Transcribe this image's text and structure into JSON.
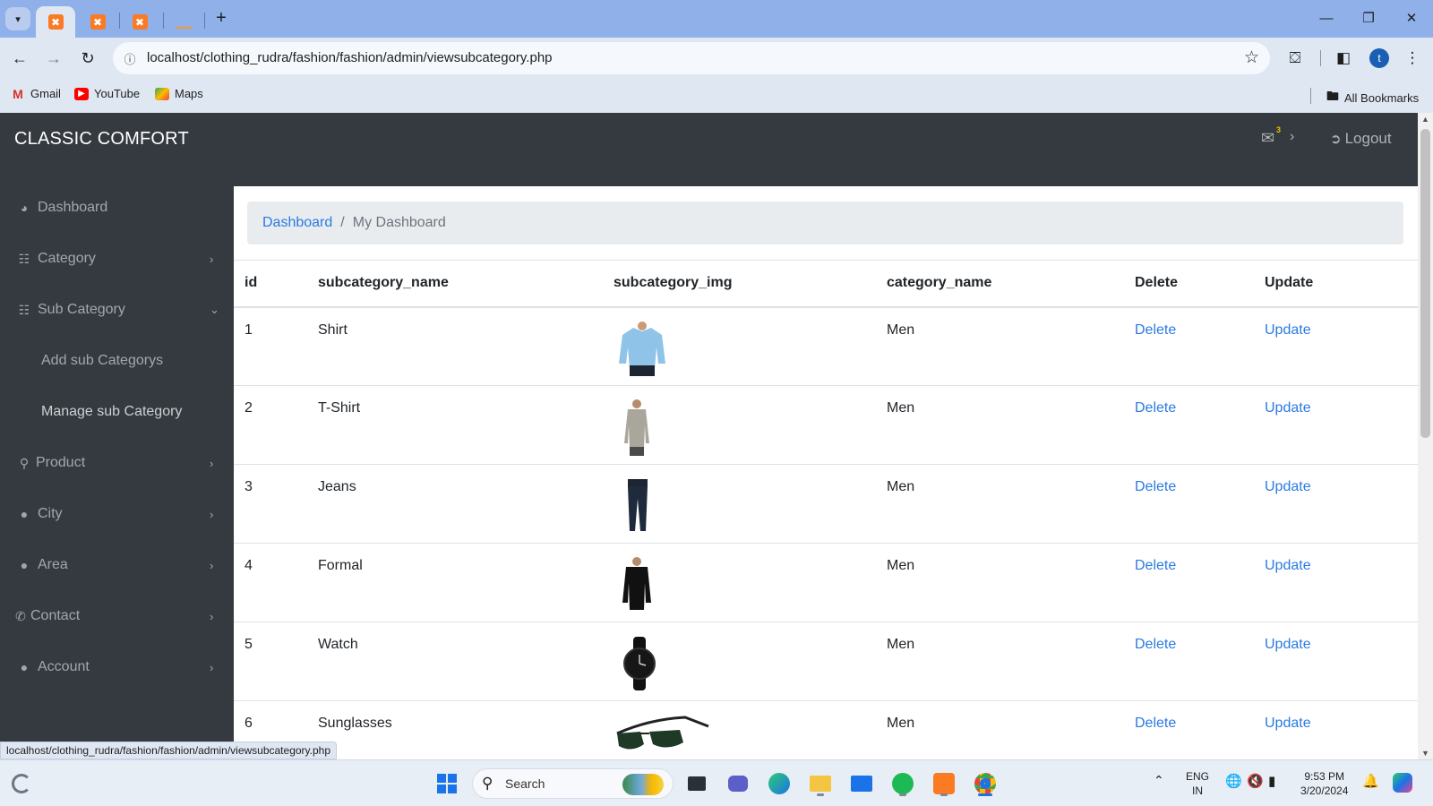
{
  "browser": {
    "tabs": [
      {
        "icon": "xampp-icon",
        "active": true
      },
      {
        "icon": "xampp-icon",
        "active": false
      },
      {
        "icon": "xampp-icon",
        "active": false
      },
      {
        "icon": "phpmyadmin-icon",
        "active": false
      }
    ],
    "url": "localhost/clothing_rudra/fashion/fashion/admin/viewsubcategory.php",
    "profile_initial": "t",
    "bookmarks": [
      {
        "label": "Gmail",
        "icon": "gmail-icon"
      },
      {
        "label": "YouTube",
        "icon": "youtube-icon"
      },
      {
        "label": "Maps",
        "icon": "maps-icon"
      }
    ],
    "all_bookmarks": "All Bookmarks",
    "status_url": "localhost/clothing_rudra/fashion/fashion/admin/viewsubcategory.php"
  },
  "app": {
    "brand": "CLASSIC COMFORT",
    "mail_badge": "3",
    "logout": "Logout"
  },
  "sidebar": {
    "items": [
      {
        "label": "Dashboard",
        "icon": "dashboard-icon",
        "chevron": ""
      },
      {
        "label": "Category",
        "icon": "sitemap-icon",
        "chevron": "›"
      },
      {
        "label": "Sub Category",
        "icon": "sitemap-icon",
        "chevron": "⌄"
      },
      {
        "label": "Add sub Categorys",
        "sub": true
      },
      {
        "label": "Manage sub Category",
        "sub": true
      },
      {
        "label": "Product",
        "icon": "basket-icon",
        "chevron": "›"
      },
      {
        "label": "City",
        "icon": "user-icon",
        "chevron": "›"
      },
      {
        "label": "Area",
        "icon": "user-icon",
        "chevron": "›"
      },
      {
        "label": "Contact",
        "icon": "phone-icon",
        "chevron": "›"
      },
      {
        "label": "Account",
        "icon": "user-icon",
        "chevron": "›"
      }
    ]
  },
  "breadcrumb": {
    "link": "Dashboard",
    "separator": "/",
    "current": "My Dashboard"
  },
  "table": {
    "headers": [
      "id",
      "subcategory_name",
      "subcategory_img",
      "category_name",
      "Delete",
      "Update"
    ],
    "rows": [
      {
        "id": "1",
        "name": "Shirt",
        "img": "shirt-image",
        "category": "Men",
        "delete": "Delete",
        "update": "Update"
      },
      {
        "id": "2",
        "name": "T-Shirt",
        "img": "tshirt-image",
        "category": "Men",
        "delete": "Delete",
        "update": "Update"
      },
      {
        "id": "3",
        "name": "Jeans",
        "img": "jeans-image",
        "category": "Men",
        "delete": "Delete",
        "update": "Update"
      },
      {
        "id": "4",
        "name": "Formal",
        "img": "formal-image",
        "category": "Men",
        "delete": "Delete",
        "update": "Update"
      },
      {
        "id": "5",
        "name": "Watch",
        "img": "watch-image",
        "category": "Men",
        "delete": "Delete",
        "update": "Update"
      },
      {
        "id": "6",
        "name": "Sunglasses",
        "img": "sunglasses-image",
        "category": "Men",
        "delete": "Delete",
        "update": "Update"
      }
    ]
  },
  "taskbar": {
    "search_placeholder": "Search",
    "lang_top": "ENG",
    "lang_bottom": "IN",
    "time": "9:53 PM",
    "date": "3/20/2024"
  },
  "colors": {
    "navbar": "#343a40",
    "link": "#2a7ae2",
    "breadcrumb_bg": "#e9ecef",
    "chrome_tabbar": "#8fb0e8",
    "chrome_toolbar": "#dfe7f3"
  }
}
